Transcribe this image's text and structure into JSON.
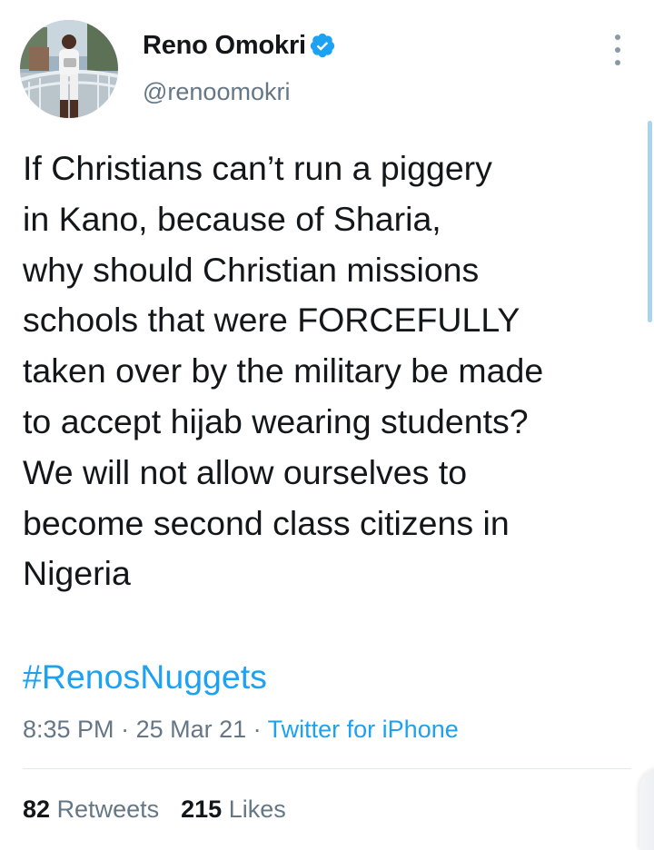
{
  "user": {
    "display_name": "Reno Omokri",
    "handle": "@renoomokri",
    "verified": true,
    "avatar_icon": "profile-photo"
  },
  "tweet": {
    "lines": [
      "If Christians can’t run a piggery",
      "in Kano, because of Sharia,",
      "why should Christian missions",
      "schools that were FORCEFULLY",
      "taken over by the military be made",
      "to accept hijab wearing students?",
      "We will not allow ourselves to",
      "become second class citizens in",
      "Nigeria"
    ],
    "hashtag": "#RenosNuggets",
    "time": "8:35 PM",
    "separator": " · ",
    "date": "25 Mar 21",
    "source": "Twitter for iPhone"
  },
  "stats": {
    "retweets_count": "82",
    "retweets_label": "Retweets",
    "likes_count": "215",
    "likes_label": "Likes"
  },
  "colors": {
    "text": "#14171a",
    "secondary": "#657786",
    "accent": "#1da1f2",
    "divider": "#e1e8ed"
  },
  "icons": {
    "verified": "verified-badge-icon",
    "more": "more-vertical-icon"
  }
}
